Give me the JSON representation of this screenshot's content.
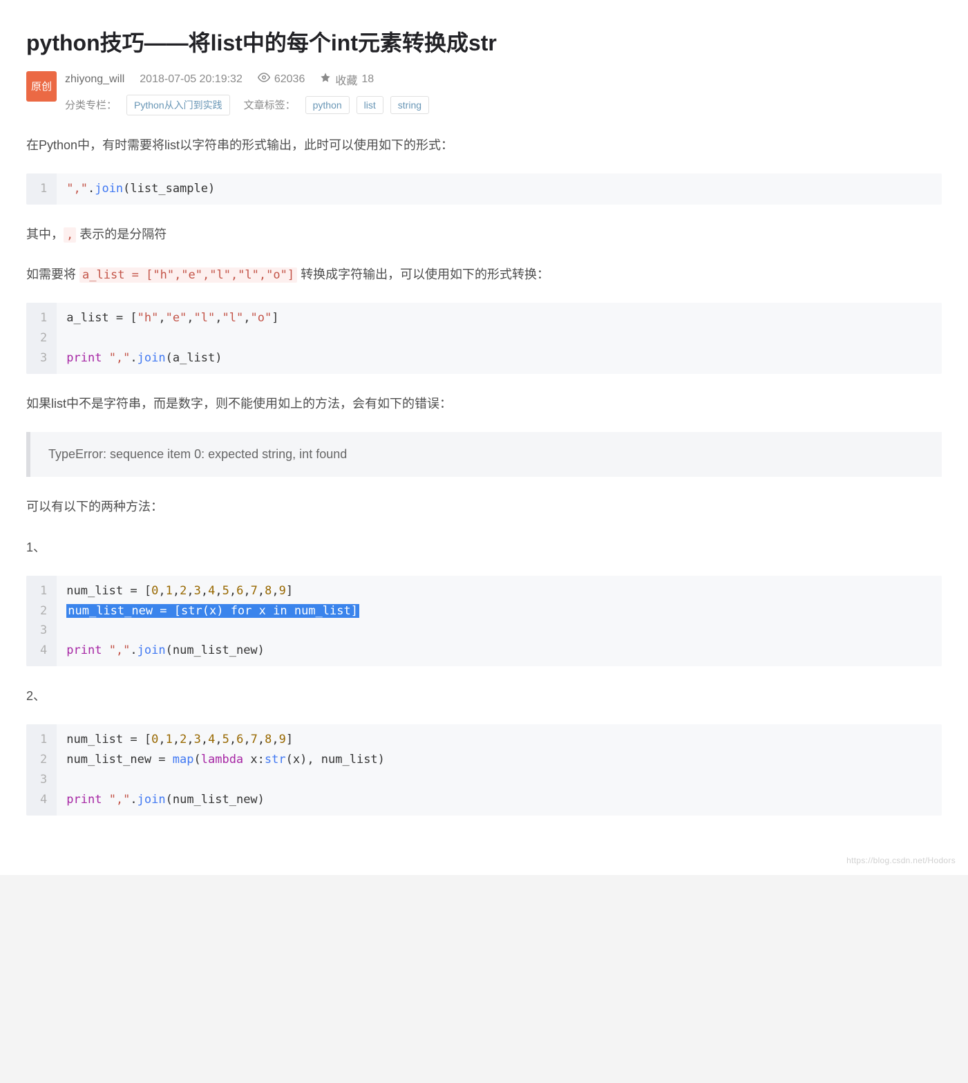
{
  "title": "python技巧——将list中的每个int元素转换成str",
  "badge": "原创",
  "author": "zhiyong_will",
  "timestamp": "2018-07-05 20:19:32",
  "views": "62036",
  "favorites_label": "收藏",
  "favorites_count": "18",
  "row2": {
    "category_label": "分类专栏：",
    "category_value": "Python从入门到实践",
    "tags_label": "文章标签：",
    "tags": [
      "python",
      "list",
      "string"
    ]
  },
  "body": {
    "p1": "在Python中，有时需要将list以字符串的形式输出，此时可以使用如下的形式：",
    "code1": {
      "nums": "1",
      "segments": [
        {
          "t": "\",\"",
          "c": "tok-str"
        },
        {
          "t": ".",
          "c": "tok-punc"
        },
        {
          "t": "join",
          "c": "tok-func"
        },
        {
          "t": "(list_sample)",
          "c": "tok-punc"
        }
      ]
    },
    "p2_pre": "其中，",
    "p2_code": ",",
    "p2_post": " 表示的是分隔符",
    "p3_pre": "如需要将 ",
    "p3_code": "a_list = [\"h\",\"e\",\"l\",\"l\",\"o\"]",
    "p3_post": " 转换成字符输出，可以使用如下的形式转换：",
    "code2": {
      "nums": "1\n2\n3",
      "lines": [
        [
          {
            "t": "a_list = [",
            "c": "tok-plain"
          },
          {
            "t": "\"h\"",
            "c": "tok-str"
          },
          {
            "t": ",",
            "c": "tok-punc"
          },
          {
            "t": "\"e\"",
            "c": "tok-str"
          },
          {
            "t": ",",
            "c": "tok-punc"
          },
          {
            "t": "\"l\"",
            "c": "tok-str"
          },
          {
            "t": ",",
            "c": "tok-punc"
          },
          {
            "t": "\"l\"",
            "c": "tok-str"
          },
          {
            "t": ",",
            "c": "tok-punc"
          },
          {
            "t": "\"o\"",
            "c": "tok-str"
          },
          {
            "t": "]",
            "c": "tok-punc"
          }
        ],
        [],
        [
          {
            "t": "print",
            "c": "tok-kw"
          },
          {
            "t": " ",
            "c": "tok-plain"
          },
          {
            "t": "\",\"",
            "c": "tok-str"
          },
          {
            "t": ".",
            "c": "tok-punc"
          },
          {
            "t": "join",
            "c": "tok-func"
          },
          {
            "t": "(a_list)",
            "c": "tok-punc"
          }
        ]
      ]
    },
    "p4": "如果list中不是字符串，而是数字，则不能使用如上的方法，会有如下的错误：",
    "error": "TypeError: sequence item 0: expected string, int found",
    "p5": "可以有以下的两种方法：",
    "p6": "1、",
    "code3": {
      "nums": "1\n2\n3\n4",
      "lines": [
        {
          "hl": false,
          "seg": [
            {
              "t": "num_list = [",
              "c": "tok-plain"
            },
            {
              "t": "0",
              "c": "tok-num"
            },
            {
              "t": ",",
              "c": "tok-punc"
            },
            {
              "t": "1",
              "c": "tok-num"
            },
            {
              "t": ",",
              "c": "tok-punc"
            },
            {
              "t": "2",
              "c": "tok-num"
            },
            {
              "t": ",",
              "c": "tok-punc"
            },
            {
              "t": "3",
              "c": "tok-num"
            },
            {
              "t": ",",
              "c": "tok-punc"
            },
            {
              "t": "4",
              "c": "tok-num"
            },
            {
              "t": ",",
              "c": "tok-punc"
            },
            {
              "t": "5",
              "c": "tok-num"
            },
            {
              "t": ",",
              "c": "tok-punc"
            },
            {
              "t": "6",
              "c": "tok-num"
            },
            {
              "t": ",",
              "c": "tok-punc"
            },
            {
              "t": "7",
              "c": "tok-num"
            },
            {
              "t": ",",
              "c": "tok-punc"
            },
            {
              "t": "8",
              "c": "tok-num"
            },
            {
              "t": ",",
              "c": "tok-punc"
            },
            {
              "t": "9",
              "c": "tok-num"
            },
            {
              "t": "]",
              "c": "tok-punc"
            }
          ]
        },
        {
          "hl": true,
          "seg": [
            {
              "t": "num_list_new = [",
              "c": "tok-plain"
            },
            {
              "t": "str",
              "c": "tok-builtin"
            },
            {
              "t": "(x) ",
              "c": "tok-punc"
            },
            {
              "t": "for",
              "c": "tok-kw"
            },
            {
              "t": " x ",
              "c": "tok-plain"
            },
            {
              "t": "in",
              "c": "tok-kw"
            },
            {
              "t": " num_list]",
              "c": "tok-plain"
            }
          ]
        },
        {
          "hl": false,
          "seg": []
        },
        {
          "hl": false,
          "seg": [
            {
              "t": "print",
              "c": "tok-kw"
            },
            {
              "t": " ",
              "c": "tok-plain"
            },
            {
              "t": "\",\"",
              "c": "tok-str"
            },
            {
              "t": ".",
              "c": "tok-punc"
            },
            {
              "t": "join",
              "c": "tok-func"
            },
            {
              "t": "(num_list_new)",
              "c": "tok-punc"
            }
          ]
        }
      ]
    },
    "p7": "2、",
    "code4": {
      "nums": "1\n2\n3\n4",
      "lines": [
        [
          {
            "t": "num_list = [",
            "c": "tok-plain"
          },
          {
            "t": "0",
            "c": "tok-num"
          },
          {
            "t": ",",
            "c": "tok-punc"
          },
          {
            "t": "1",
            "c": "tok-num"
          },
          {
            "t": ",",
            "c": "tok-punc"
          },
          {
            "t": "2",
            "c": "tok-num"
          },
          {
            "t": ",",
            "c": "tok-punc"
          },
          {
            "t": "3",
            "c": "tok-num"
          },
          {
            "t": ",",
            "c": "tok-punc"
          },
          {
            "t": "4",
            "c": "tok-num"
          },
          {
            "t": ",",
            "c": "tok-punc"
          },
          {
            "t": "5",
            "c": "tok-num"
          },
          {
            "t": ",",
            "c": "tok-punc"
          },
          {
            "t": "6",
            "c": "tok-num"
          },
          {
            "t": ",",
            "c": "tok-punc"
          },
          {
            "t": "7",
            "c": "tok-num"
          },
          {
            "t": ",",
            "c": "tok-punc"
          },
          {
            "t": "8",
            "c": "tok-num"
          },
          {
            "t": ",",
            "c": "tok-punc"
          },
          {
            "t": "9",
            "c": "tok-num"
          },
          {
            "t": "]",
            "c": "tok-punc"
          }
        ],
        [
          {
            "t": "num_list_new = ",
            "c": "tok-plain"
          },
          {
            "t": "map",
            "c": "tok-builtin"
          },
          {
            "t": "(",
            "c": "tok-punc"
          },
          {
            "t": "lambda",
            "c": "tok-kw"
          },
          {
            "t": " x:",
            "c": "tok-plain"
          },
          {
            "t": "str",
            "c": "tok-builtin"
          },
          {
            "t": "(x), num_list)",
            "c": "tok-punc"
          }
        ],
        [],
        [
          {
            "t": "print",
            "c": "tok-kw"
          },
          {
            "t": " ",
            "c": "tok-plain"
          },
          {
            "t": "\",\"",
            "c": "tok-str"
          },
          {
            "t": ".",
            "c": "tok-punc"
          },
          {
            "t": "join",
            "c": "tok-func"
          },
          {
            "t": "(num_list_new)",
            "c": "tok-punc"
          }
        ]
      ]
    }
  },
  "watermark": "https://blog.csdn.net/Hodors"
}
